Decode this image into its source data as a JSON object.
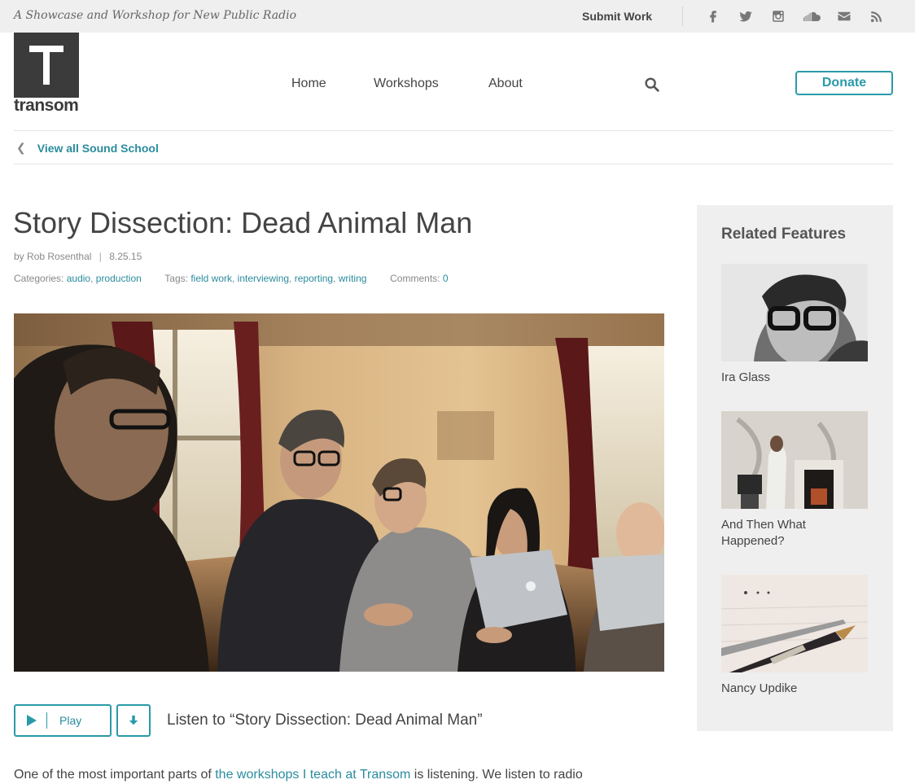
{
  "topbar": {
    "tagline": "A Showcase and Workshop for New Public Radio",
    "submit_label": "Submit Work",
    "social": [
      "facebook-icon",
      "twitter-icon",
      "instagram-icon",
      "soundcloud-icon",
      "mail-icon",
      "rss-icon"
    ]
  },
  "logo": {
    "word": "transom"
  },
  "nav": {
    "items": [
      "Home",
      "Workshops",
      "About"
    ],
    "donate_label": "Donate"
  },
  "breadcrumb": {
    "back_label": "View all Sound School"
  },
  "article": {
    "title": "Story Dissection: Dead Animal Man",
    "byline_prefix": "by",
    "author": "Rob Rosenthal",
    "date": "8.25.15",
    "categories_label": "Categories:",
    "categories": [
      "audio",
      "production"
    ],
    "tags_label": "Tags:",
    "tags": [
      "field work",
      "interviewing",
      "reporting",
      "writing"
    ],
    "comments_label": "Comments:",
    "comments_count": "0"
  },
  "player": {
    "play_label": "Play",
    "listen_text": "Listen to “Story Dissection: Dead Animal Man”"
  },
  "body": {
    "pre": "One of the most important parts of ",
    "link": "the workshops I teach at Transom",
    "post": " is listening. We listen to radio"
  },
  "sidebar": {
    "heading": "Related Features",
    "features": [
      {
        "caption": "Ira Glass"
      },
      {
        "caption": "And Then What Happened?"
      },
      {
        "caption": "Nancy Updike"
      }
    ]
  },
  "colors": {
    "accent": "#2a9aa8",
    "link": "#2a8c9e",
    "logo": "#3b3b3b"
  }
}
